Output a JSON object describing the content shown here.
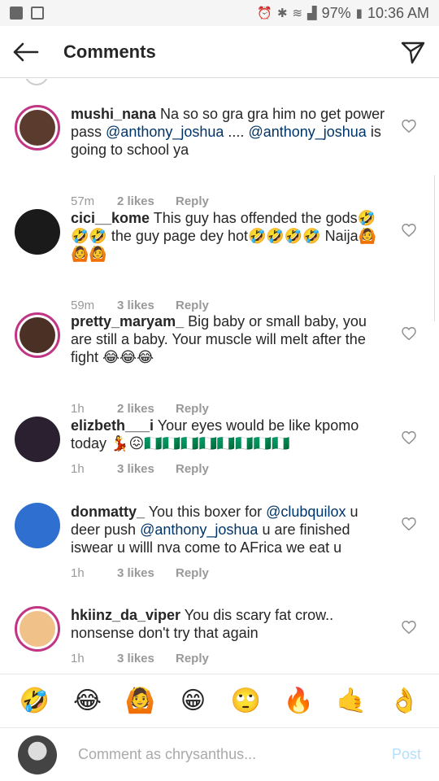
{
  "status": {
    "battery": "97%",
    "time": "10:36 AM"
  },
  "header": {
    "title": "Comments"
  },
  "comments": [
    {
      "user": "mushi_nana",
      "text_parts": [
        {
          "t": " Na so so gra gra him no get power pass ",
          "m": false
        },
        {
          "t": "@anthony_joshua",
          "m": true
        },
        {
          "t": " .... ",
          "m": false
        },
        {
          "t": "@anthony_joshua",
          "m": true
        },
        {
          "t": " is going to school ya",
          "m": false
        }
      ],
      "time": "57m",
      "likes": "2 likes",
      "reply": "Reply",
      "avatar_color": "#5a3b2e"
    },
    {
      "user": "cici__kome",
      "text_parts": [
        {
          "t": " This guy has offended the gods🤣🤣🤣 the guy page dey hot🤣🤣🤣🤣 Naija🙆🙆🙆",
          "m": false
        }
      ],
      "time": "59m",
      "likes": "3 likes",
      "reply": "Reply",
      "avatar_color": "#1a1a1a"
    },
    {
      "user": "pretty_maryam_",
      "text_parts": [
        {
          "t": " Big baby or small baby, you are still a baby. Your muscle will melt after the fight 😂😂😂",
          "m": false
        }
      ],
      "time": "1h",
      "likes": "2 likes",
      "reply": "Reply",
      "avatar_color": "#4a3025"
    },
    {
      "user": "elizbeth___i",
      "text_parts": [
        {
          "t": " Your eyes would be like kpomo today 💃😖🇳🇬🇳🇬🇳🇬🇳🇬🇳🇬🇳🇬🇳🇬🇳🇬",
          "m": false
        }
      ],
      "time": "1h",
      "likes": "3 likes",
      "reply": "Reply",
      "avatar_color": "#2b2030"
    },
    {
      "user": "donmatty_",
      "text_parts": [
        {
          "t": " You this boxer for ",
          "m": false
        },
        {
          "t": "@clubquilox",
          "m": true
        },
        {
          "t": " u deer push ",
          "m": false
        },
        {
          "t": "@anthony_joshua",
          "m": true
        },
        {
          "t": " u are finished iswear u willl nva come to AFrica we eat u",
          "m": false
        }
      ],
      "time": "1h",
      "likes": "3 likes",
      "reply": "Reply",
      "avatar_color": "#2f6fd0"
    },
    {
      "user": "hkiinz_da_viper",
      "text_parts": [
        {
          "t": " You dis scary fat crow.. nonsense don't try that again",
          "m": false
        }
      ],
      "time": "1h",
      "likes": "3 likes",
      "reply": "Reply",
      "avatar_color": "#f0c28a"
    }
  ],
  "emoji_bar": [
    "🤣",
    "😂",
    "🙆",
    "😁",
    "🙄",
    "🔥",
    "🤙",
    "👌"
  ],
  "composer": {
    "placeholder": "Comment as chrysanthus...",
    "post_label": "Post"
  }
}
